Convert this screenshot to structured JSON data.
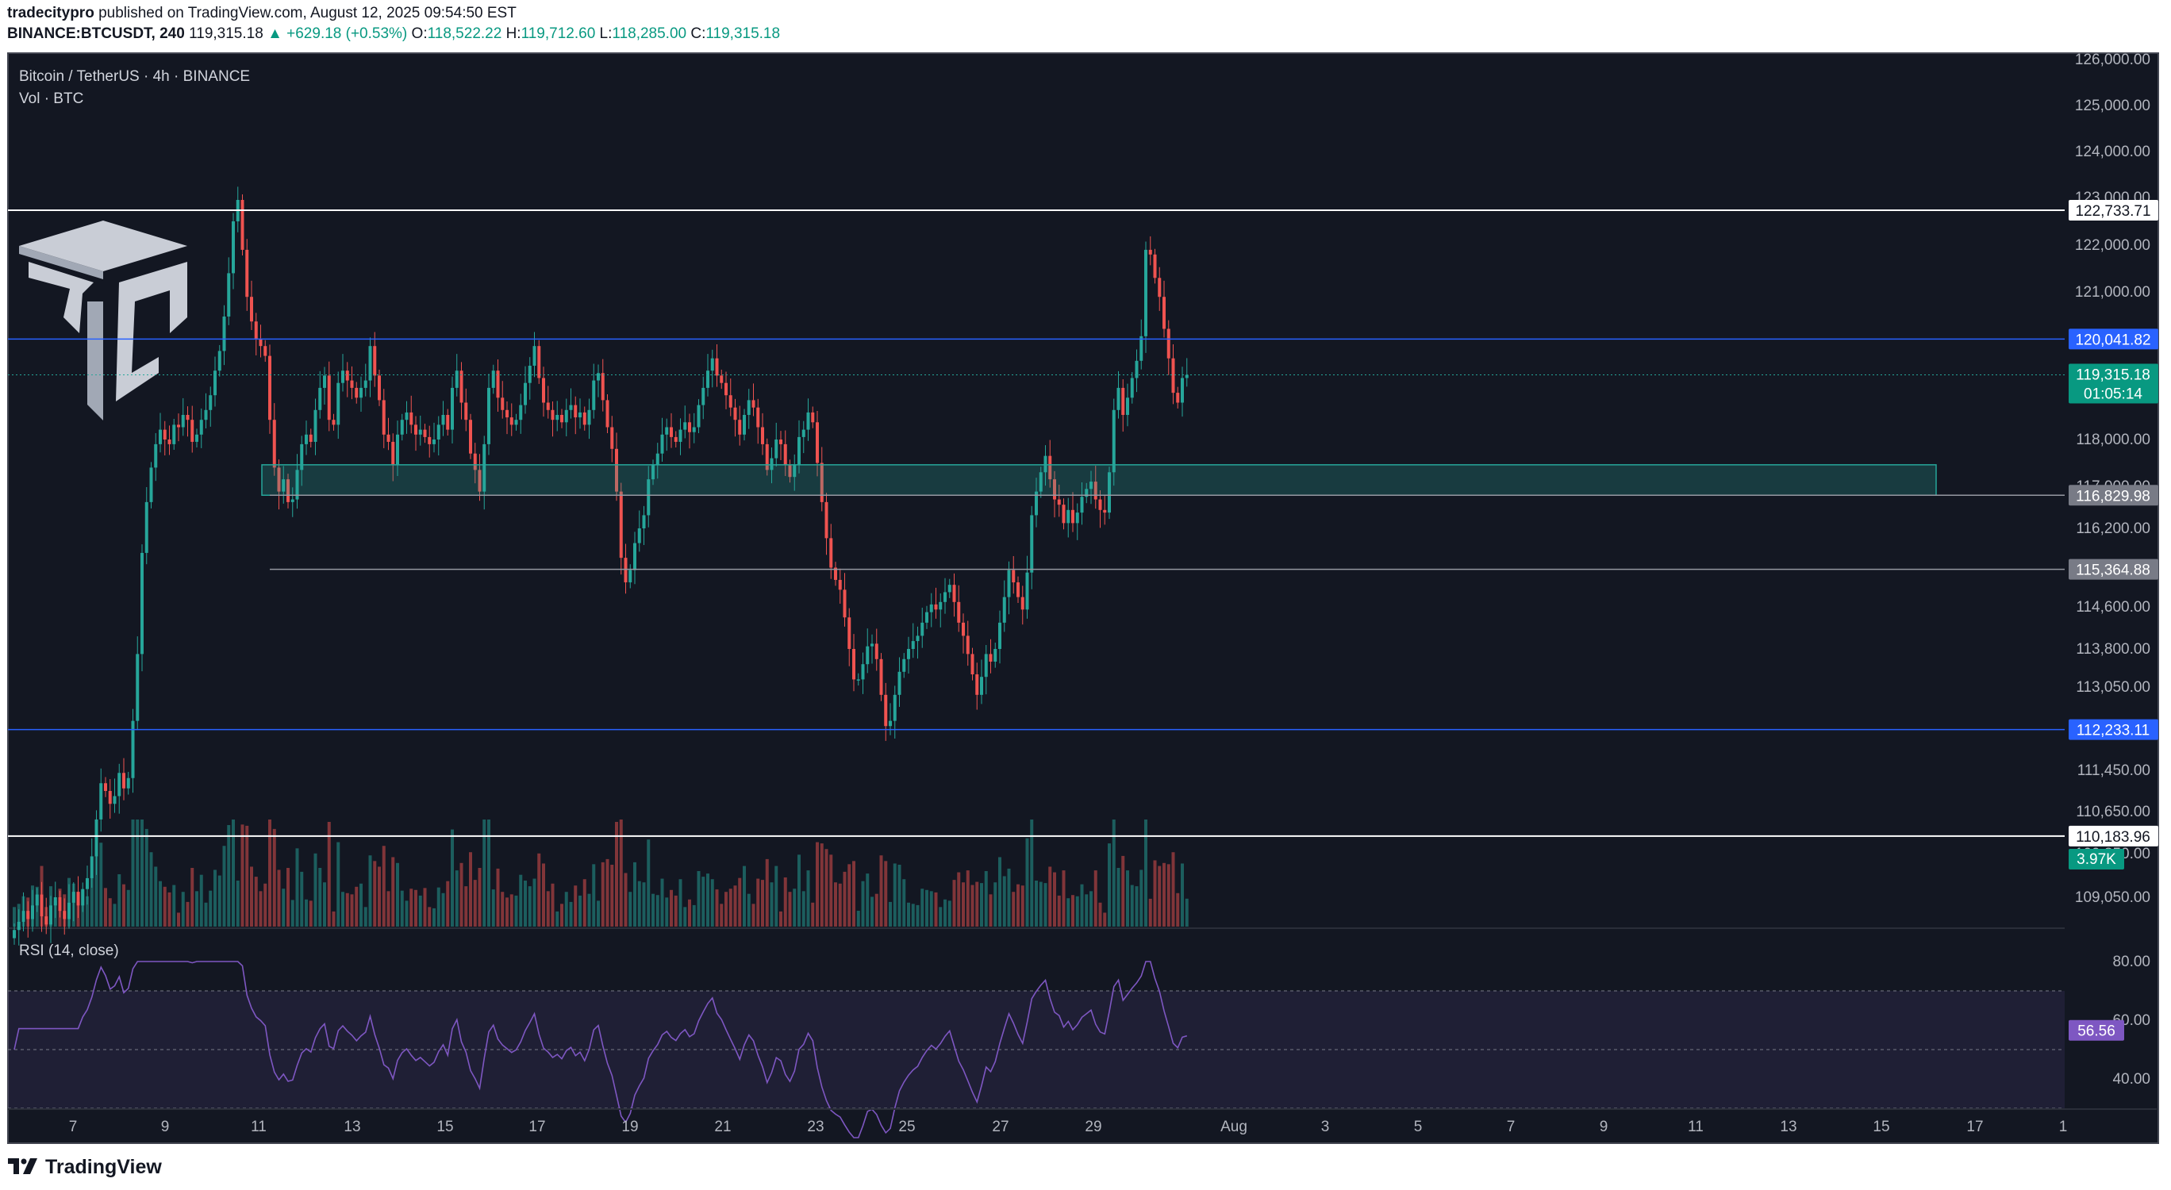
{
  "header": {
    "author": "tradecitypro",
    "published_text": "published on TradingView.com, August 12, 2025 09:54:50 EST",
    "symbol_line": "BINANCE:BTCUSDT, 240",
    "last": "119,315.18",
    "change": "▲ +629.18 (+0.53%)",
    "o_label": "O:",
    "o_value": "118,522.22",
    "h_label": "H:",
    "h_value": "119,712.60",
    "l_label": "L:",
    "l_value": "118,285.00",
    "c_label": "C:",
    "c_value": "119,315.18"
  },
  "legend": {
    "title": "Bitcoin / TetherUS · 4h · BINANCE",
    "volume": "Vol · BTC",
    "rsi": "RSI (14, close)"
  },
  "footer": {
    "brand": "TradingView"
  },
  "colors": {
    "up": "#26a69a",
    "down": "#ef5350",
    "bg": "#131722",
    "rsi": "#7e57c2",
    "level_white": "#ffffff",
    "level_blue": "#2962ff"
  },
  "chart_data": {
    "type": "candlestick",
    "title": "Bitcoin / TetherUS · 4h · BINANCE",
    "y_ticks": [
      "126,000.00",
      "125,000.00",
      "124,000.00",
      "123,000.00",
      "122,000.00",
      "121,000.00",
      "118,000.00",
      "117,000.00",
      "116,200.00",
      "114,600.00",
      "113,800.00",
      "113,050.00",
      "111,450.00",
      "110,650.00",
      "109,850.00",
      "109,050.00"
    ],
    "y_range": [
      108700,
      126200
    ],
    "x_ticks": [
      "7",
      "9",
      "11",
      "13",
      "15",
      "17",
      "19",
      "21",
      "23",
      "25",
      "27",
      "29",
      "Aug",
      "3",
      "5",
      "7",
      "9",
      "11",
      "13",
      "15",
      "17",
      "1"
    ],
    "levels": [
      {
        "value": 122733.71,
        "label": "122,733.71",
        "style": "white"
      },
      {
        "value": 120041.82,
        "label": "120,041.82",
        "style": "blue"
      },
      {
        "value": 116829.98,
        "label": "116,829.98",
        "style": "grey"
      },
      {
        "value": 115364.88,
        "label": "115,364.88",
        "style": "grey"
      },
      {
        "value": 112233.11,
        "label": "112,233.11",
        "style": "blue"
      },
      {
        "value": 110183.96,
        "label": "110,183.96",
        "style": "white"
      }
    ],
    "zone": {
      "from": 116830,
      "to": 117460
    },
    "last_price": {
      "value": 119315.18,
      "label": "119,315.18",
      "countdown": "01:05:14"
    },
    "volume_last": "3.97K",
    "rsi": {
      "name": "RSI (14, close)",
      "last": "56.56",
      "upper": 70,
      "middle": 50,
      "lower": 30,
      "ticks": [
        "80.00",
        "60.00",
        "40.00"
      ]
    },
    "series": [
      {
        "name": "Bitcoin / TetherUS",
        "close": [
          108450,
          108600,
          108800,
          108650,
          108900,
          109100,
          108700,
          108550,
          108900,
          109050,
          108800,
          108650,
          108950,
          109150,
          108900,
          109200,
          109400,
          109800,
          110500,
          111200,
          111050,
          110800,
          110950,
          111400,
          111100,
          111300,
          112400,
          113700,
          115700,
          116700,
          117400,
          117900,
          118200,
          118000,
          117900,
          118300,
          118250,
          118500,
          118400,
          117950,
          118100,
          118400,
          118600,
          118900,
          119400,
          119800,
          120500,
          121400,
          122500,
          122950,
          121900,
          120900,
          120400,
          120050,
          119900,
          119700,
          118400,
          117400,
          116900,
          117150,
          116700,
          116750,
          117350,
          117900,
          118100,
          117950,
          118600,
          119050,
          119300,
          118400,
          118300,
          119150,
          119400,
          119200,
          119050,
          118850,
          119050,
          119200,
          119900,
          119300,
          118800,
          118100,
          117950,
          117450,
          118100,
          118400,
          118550,
          118300,
          118100,
          118200,
          118050,
          117900,
          118000,
          118300,
          118500,
          118200,
          119050,
          119400,
          118750,
          118400,
          117700,
          117350,
          116900,
          117900,
          119050,
          119400,
          118850,
          118600,
          118450,
          118300,
          118400,
          118700,
          119150,
          119500,
          119900,
          119250,
          118750,
          118600,
          118400,
          118500,
          118350,
          118600,
          118700,
          118450,
          118550,
          118300,
          118600,
          119200,
          119350,
          118800,
          118250,
          117800,
          116900,
          115600,
          115100,
          115350,
          115900,
          116200,
          116450,
          117150,
          117450,
          117700,
          118100,
          118250,
          118050,
          117950,
          118200,
          118350,
          118150,
          118250,
          118700,
          119050,
          119400,
          119650,
          119300,
          119150,
          118900,
          118650,
          118400,
          118100,
          118500,
          118800,
          118650,
          118250,
          117900,
          117350,
          117600,
          118000,
          117900,
          117450,
          117200,
          117450,
          118050,
          118200,
          118550,
          118350,
          117500,
          116700,
          116000,
          115400,
          115150,
          114950,
          114400,
          113800,
          113200,
          113200,
          113500,
          113850,
          113900,
          113600,
          112900,
          112300,
          112400,
          112900,
          113350,
          113600,
          113800,
          113950,
          114050,
          114300,
          114500,
          114650,
          114550,
          114700,
          114900,
          115050,
          114700,
          114300,
          114050,
          113700,
          113300,
          112900,
          113250,
          113700,
          113550,
          113800,
          114300,
          114800,
          115350,
          115100,
          114800,
          114550,
          115300,
          116450,
          116900,
          117300,
          117650,
          117150,
          116750,
          116650,
          116300,
          116550,
          116300,
          116500,
          116800,
          116950,
          117100,
          116750,
          116550,
          116500,
          117300,
          118600,
          119050,
          118500,
          118850,
          119250,
          119600,
          120100,
          121900,
          121800,
          121300,
          120900,
          120250,
          119650,
          118950,
          118750,
          119250,
          119315
        ]
      }
    ]
  }
}
